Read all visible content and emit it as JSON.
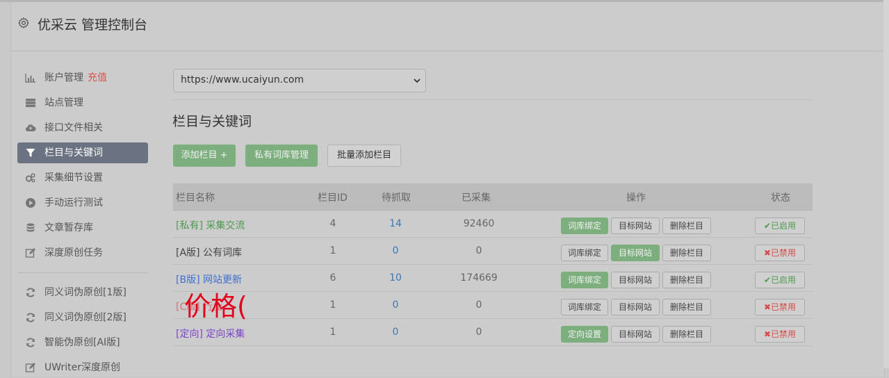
{
  "header": {
    "title": "优采云 管理控制台"
  },
  "sidebar": {
    "items": [
      {
        "label": "账户管理",
        "extra": "充值",
        "icon": "bar-chart-icon"
      },
      {
        "label": "站点管理",
        "icon": "server-icon"
      },
      {
        "label": "接口文件相关",
        "icon": "cloud-upload-icon"
      },
      {
        "label": "栏目与关键词",
        "icon": "filter-icon",
        "active": true
      },
      {
        "label": "采集细节设置",
        "icon": "cogs-icon"
      },
      {
        "label": "手动运行测试",
        "icon": "play-circle-icon"
      },
      {
        "label": "文章暂存库",
        "icon": "database-icon"
      },
      {
        "label": "深度原创任务",
        "icon": "edit-icon"
      },
      {
        "label": "同义词伪原创[1版]",
        "icon": "refresh-icon"
      },
      {
        "label": "同义词伪原创[2版]",
        "icon": "refresh-icon"
      },
      {
        "label": "智能伪原创[AI版]",
        "icon": "refresh-icon"
      },
      {
        "label": "UWriter深度原创",
        "icon": "edit-icon"
      }
    ]
  },
  "site_select": {
    "value": "https://www.ucaiyun.com"
  },
  "section": {
    "title": "栏目与关键词"
  },
  "toolbar": {
    "add_column": "添加栏目 +",
    "private_lib": "私有词库管理",
    "batch_add": "批量添加栏目"
  },
  "table": {
    "headers": {
      "name": "栏目名称",
      "id": "栏目ID",
      "pending": "待抓取",
      "collected": "已采集",
      "ops": "操作",
      "status": "状态"
    },
    "rows": [
      {
        "name": "[私有] 采集交流",
        "id": "4",
        "pending": "14",
        "collected": "92460",
        "op1": "词库绑定",
        "op2": "目标网站",
        "op3": "删除栏目",
        "status": "已启用"
      },
      {
        "name": "[A版] 公有词库",
        "id": "1",
        "pending": "0",
        "collected": "0",
        "op1": "词库绑定",
        "op2": "目标网站",
        "op3": "删除栏目",
        "status": "已禁用"
      },
      {
        "name": "[B版] 网站更新",
        "id": "6",
        "pending": "10",
        "collected": "174669",
        "op1": "词库绑定",
        "op2": "目标网站",
        "op3": "删除栏目",
        "status": "已启用"
      },
      {
        "name": "[C版] 行业",
        "id": "1",
        "pending": "0",
        "collected": "0",
        "op1": "词库绑定",
        "op2": "目标网站",
        "op3": "删除栏目",
        "status": "已禁用"
      },
      {
        "name": "[定向] 定向采集",
        "id": "1",
        "pending": "0",
        "collected": "0",
        "op1": "定向设置",
        "op2": "目标网站",
        "op3": "删除栏目",
        "status": "已禁用"
      }
    ]
  },
  "overlay": {
    "text": "价格("
  },
  "colors": {
    "active_bg": "#6b7382",
    "green": "#7cae7e",
    "red": "#d64b4b",
    "overlay_red": "#e4001b"
  }
}
